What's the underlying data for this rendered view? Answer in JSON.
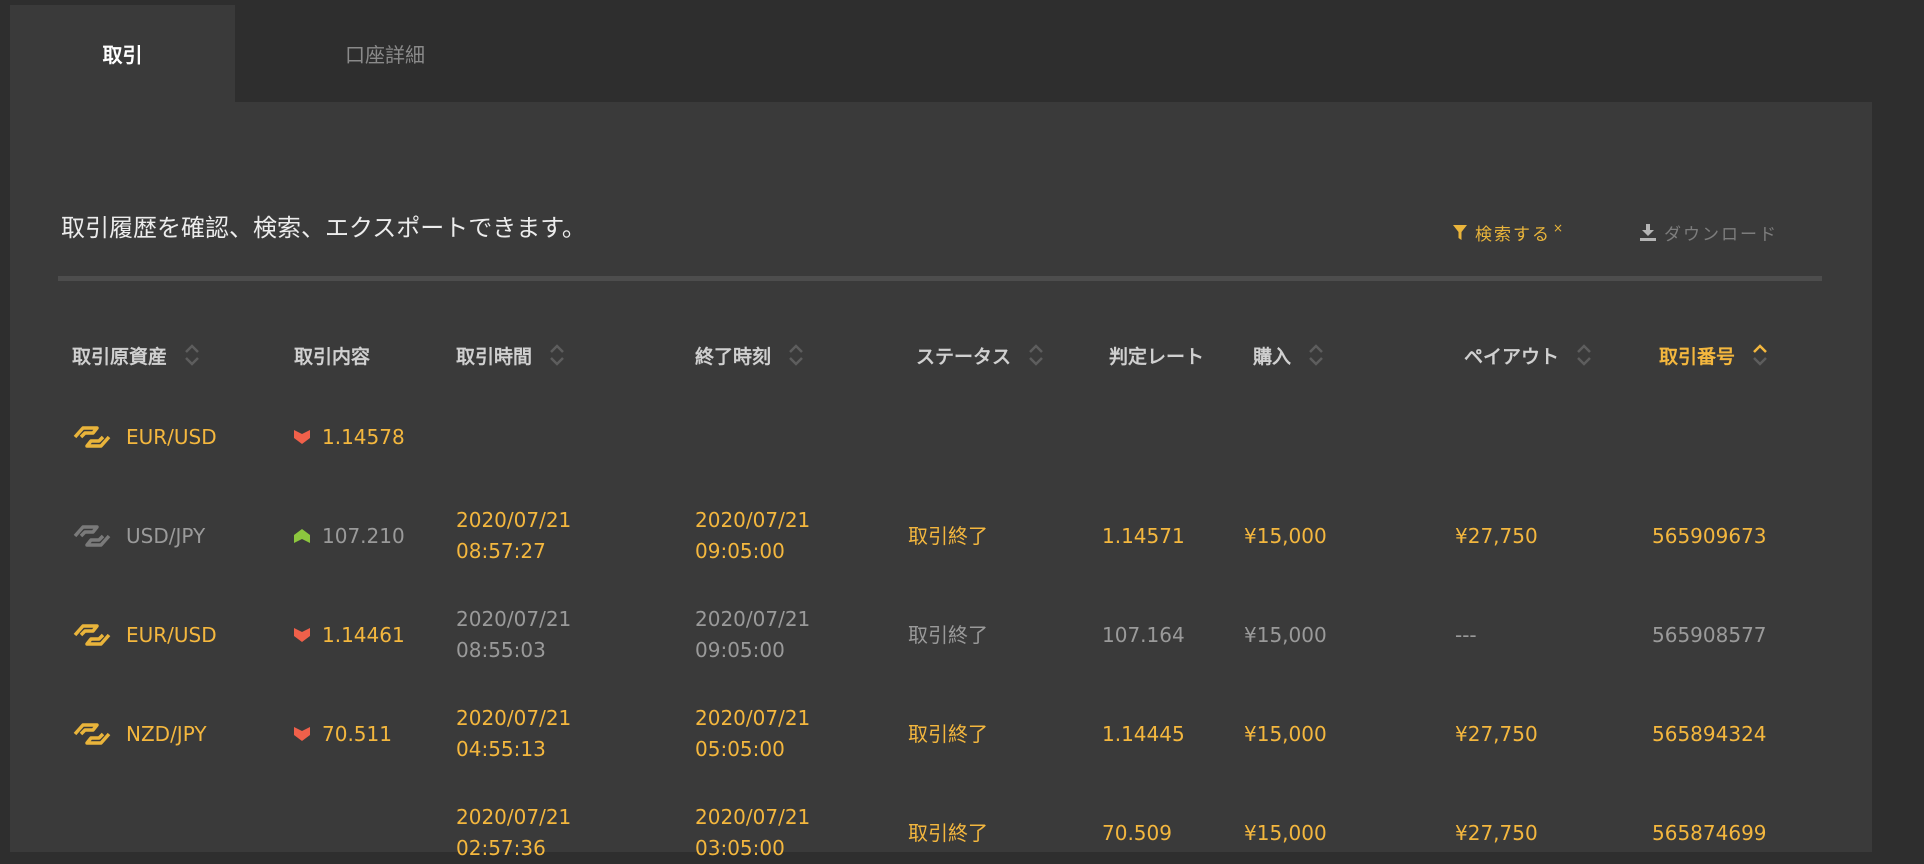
{
  "tabs": [
    {
      "label": "取引",
      "active": true
    },
    {
      "label": "口座詳細",
      "active": false
    }
  ],
  "intro_text": "取引履歴を確認、検索、エクスポートできます。",
  "actions": {
    "search_label": "検索する",
    "search_badge": "×",
    "download_label": "ダウンロード"
  },
  "columns": [
    {
      "label": "取引原資産",
      "sortable": true
    },
    {
      "label": "取引内容",
      "sortable": false
    },
    {
      "label": "取引時間",
      "sortable": true
    },
    {
      "label": "終了時刻",
      "sortable": true
    },
    {
      "label": "ステータス",
      "sortable": true
    },
    {
      "label": "判定レート",
      "sortable": false
    },
    {
      "label": "購入",
      "sortable": true
    },
    {
      "label": "ペイアウト",
      "sortable": true
    },
    {
      "label": "取引番号",
      "sortable": true,
      "active": true
    }
  ],
  "rows": [
    {
      "asset": "EUR/USD",
      "direction": "down",
      "entry": "1.14578",
      "trade_date": "2020/07/21",
      "trade_time": "08:57:27",
      "end_date": "2020/07/21",
      "end_time": "09:05:00",
      "status": "取引終了",
      "rate": "1.14571",
      "purchase": "¥15,000",
      "payout": "¥27,750",
      "trade_no": "565909673",
      "won": true
    },
    {
      "asset": "USD/JPY",
      "direction": "up",
      "entry": "107.210",
      "trade_date": "2020/07/21",
      "trade_time": "08:55:03",
      "end_date": "2020/07/21",
      "end_time": "09:05:00",
      "status": "取引終了",
      "rate": "107.164",
      "purchase": "¥15,000",
      "payout": "---",
      "trade_no": "565908577",
      "won": false
    },
    {
      "asset": "EUR/USD",
      "direction": "down",
      "entry": "1.14461",
      "trade_date": "2020/07/21",
      "trade_time": "04:55:13",
      "end_date": "2020/07/21",
      "end_time": "05:05:00",
      "status": "取引終了",
      "rate": "1.14445",
      "purchase": "¥15,000",
      "payout": "¥27,750",
      "trade_no": "565894324",
      "won": true
    },
    {
      "asset": "NZD/JPY",
      "direction": "down",
      "entry": "70.511",
      "trade_date": "2020/07/21",
      "trade_time": "02:57:36",
      "end_date": "2020/07/21",
      "end_time": "03:05:00",
      "status": "取引終了",
      "rate": "70.509",
      "purchase": "¥15,000",
      "payout": "¥27,750",
      "trade_no": "565874699",
      "won": true
    }
  ],
  "colors": {
    "win": "#f4b73e",
    "loss": "#9a9a9a",
    "down_arrow": "#f0604a",
    "up_arrow": "#8cc63e",
    "asset_icon_win": "#e9b43b",
    "asset_icon_loss": "#7a7a7a"
  },
  "icons": {
    "search": "filter-icon",
    "download": "download-icon",
    "asset": "asset-link-icon",
    "sort": "sort-arrows-icon",
    "direction_down": "arrow-down-icon",
    "direction_up": "arrow-up-icon"
  }
}
